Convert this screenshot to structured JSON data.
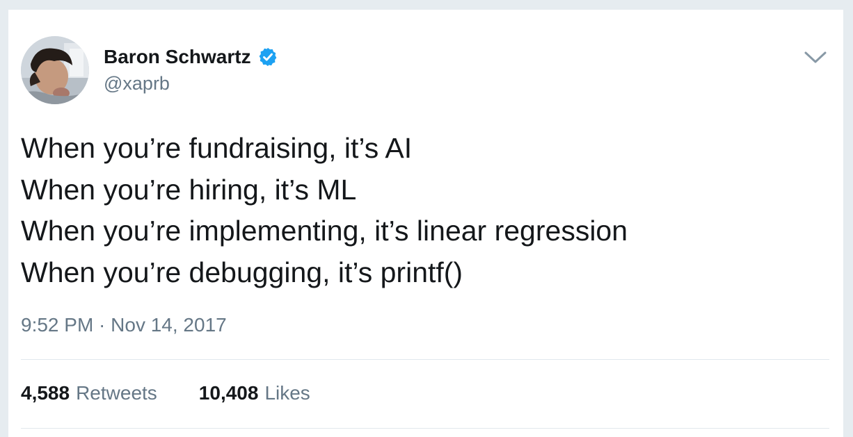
{
  "author": {
    "display_name": "Baron Schwartz",
    "handle": "@xaprb",
    "verified": true,
    "avatar_icon": "user-avatar"
  },
  "menu_icon": "chevron-down-icon",
  "tweet": {
    "lines": [
      "When you’re fundraising, it’s AI",
      "When you’re hiring, it’s ML",
      "When you’re implementing, it’s linear regression",
      "When you’re debugging, it’s printf()"
    ],
    "timestamp": "9:52 PM · Nov 14, 2017"
  },
  "stats": {
    "retweets": {
      "count": "4,588",
      "label": "Retweets"
    },
    "likes": {
      "count": "10,408",
      "label": "Likes"
    }
  },
  "colors": {
    "background": "#e6ecf0",
    "card": "#ffffff",
    "text_primary": "#14171a",
    "text_secondary": "#657786",
    "verified_blue": "#1da1f2",
    "divider": "#e1e8ed"
  }
}
